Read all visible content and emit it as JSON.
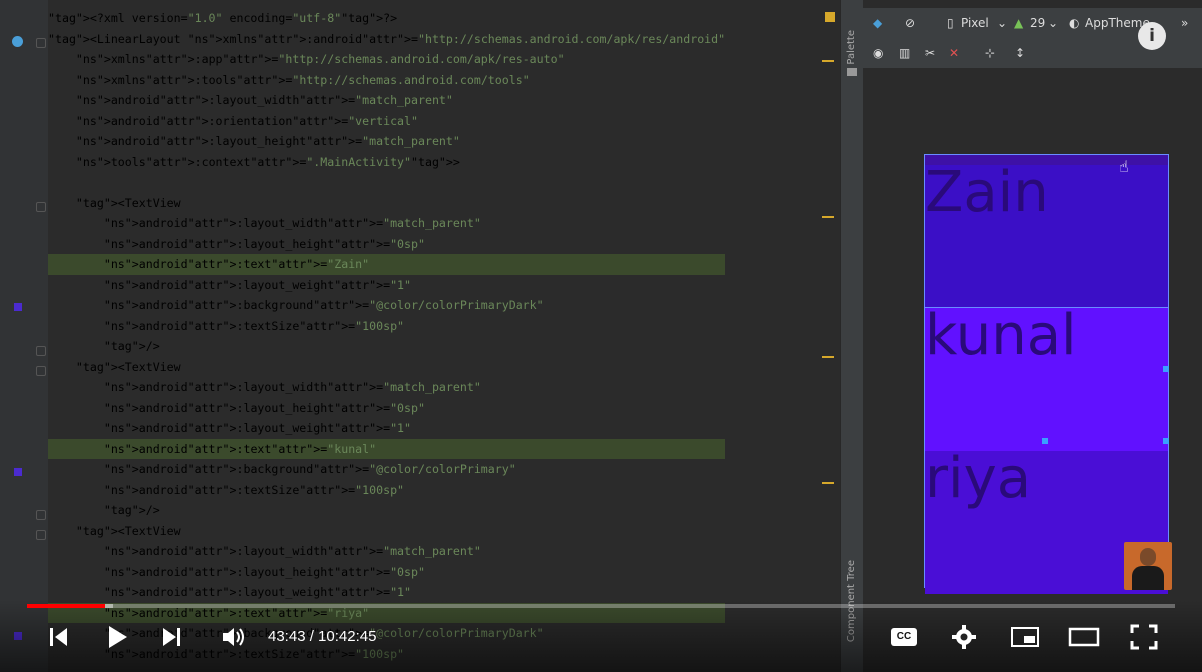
{
  "editor": {
    "lines": [
      [
        "<?xml version=\"1.0\" encoding=\"utf-8\"?>"
      ],
      [
        "<LinearLayout xmlns:android=\"http://schemas.android.com/apk/res/android\""
      ],
      [
        "    xmlns:app=\"http://schemas.android.com/apk/res-auto\""
      ],
      [
        "    xmlns:tools=\"http://schemas.android.com/tools\""
      ],
      [
        "    android:layout_width=\"match_parent\""
      ],
      [
        "    android:orientation=\"vertical\""
      ],
      [
        "    android:layout_height=\"match_parent\""
      ],
      [
        "    tools:context=\".MainActivity\">"
      ],
      [
        ""
      ],
      [
        "    <TextView"
      ],
      [
        "        android:layout_width=\"match_parent\""
      ],
      [
        "        android:layout_height=\"0sp\""
      ],
      [
        "        android:text=\"Zain\""
      ],
      [
        "        android:layout_weight=\"1\""
      ],
      [
        "        android:background=\"@color/colorPrimaryDark\""
      ],
      [
        "        android:textSize=\"100sp\""
      ],
      [
        "        />"
      ],
      [
        "    <TextView"
      ],
      [
        "        android:layout_width=\"match_parent\""
      ],
      [
        "        android:layout_height=\"0sp\""
      ],
      [
        "        android:layout_weight=\"1\""
      ],
      [
        "        android:text=\"kunal\""
      ],
      [
        "        android:background=\"@color/colorPrimary\""
      ],
      [
        "        android:textSize=\"100sp\""
      ],
      [
        "        />"
      ],
      [
        "    <TextView"
      ],
      [
        "        android:layout_width=\"match_parent\""
      ],
      [
        "        android:layout_height=\"0sp\""
      ],
      [
        "        android:layout_weight=\"1\""
      ],
      [
        "        android:text=\"riya\""
      ],
      [
        "        android:background=\"@color/colorPrimaryDark\""
      ],
      [
        "        android:textSize=\"100sp\""
      ]
    ]
  },
  "sidebar": {
    "palette_label": "Palette",
    "component_tree_label": "Component Tree"
  },
  "design_toolbar": {
    "device": "Pixel",
    "api": "29",
    "theme": "AppTheme",
    "more": "»"
  },
  "preview": {
    "texts": [
      "Zain",
      "kunal",
      "riya"
    ]
  },
  "info_label": "i",
  "player": {
    "current_time": "43:43",
    "duration": "10:42:45",
    "time_display": "43:43 / 10:42:45",
    "progress_fraction": 0.068,
    "buffered_fraction": 0.075,
    "cc_label": "CC"
  }
}
